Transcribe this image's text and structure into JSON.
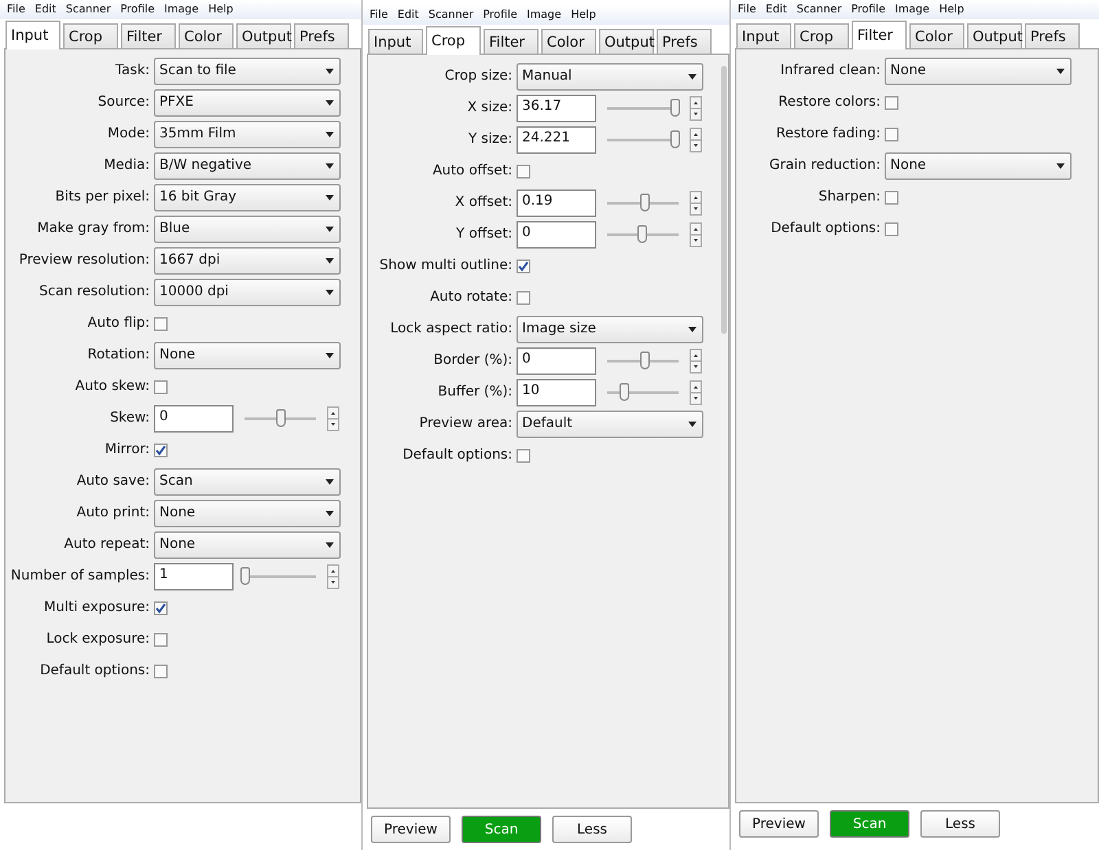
{
  "panels": [
    {
      "menu": [
        "File",
        "Edit",
        "Scanner",
        "Profile",
        "Image",
        "Help"
      ],
      "tabs": [
        {
          "label": "Input",
          "selected": true
        },
        {
          "label": "Crop",
          "selected": false
        },
        {
          "label": "Filter",
          "selected": false
        },
        {
          "label": "Color",
          "selected": false
        },
        {
          "label": "Output",
          "selected": false
        },
        {
          "label": "Prefs",
          "selected": false
        }
      ],
      "rows": [
        {
          "kind": "select",
          "label": "Task:",
          "value": "Scan to file"
        },
        {
          "kind": "select",
          "label": "Source:",
          "value": "PFXE"
        },
        {
          "kind": "select",
          "label": "Mode:",
          "value": "35mm Film"
        },
        {
          "kind": "select",
          "label": "Media:",
          "value": "B/W negative"
        },
        {
          "kind": "select",
          "label": "Bits per pixel:",
          "value": "16 bit Gray"
        },
        {
          "kind": "select",
          "label": "Make gray from:",
          "value": "Blue"
        },
        {
          "kind": "select",
          "label": "Preview resolution:",
          "value": "1667 dpi"
        },
        {
          "kind": "select",
          "label": "Scan resolution:",
          "value": "10000 dpi"
        },
        {
          "kind": "check",
          "label": "Auto flip:",
          "checked": false
        },
        {
          "kind": "select",
          "label": "Rotation:",
          "value": "None"
        },
        {
          "kind": "check",
          "label": "Auto skew:",
          "checked": false
        },
        {
          "kind": "spin",
          "label": "Skew:",
          "value": "0",
          "level": 0.5
        },
        {
          "kind": "check",
          "label": "Mirror:",
          "checked": true
        },
        {
          "kind": "select",
          "label": "Auto save:",
          "value": "Scan"
        },
        {
          "kind": "select",
          "label": "Auto print:",
          "value": "None"
        },
        {
          "kind": "select",
          "label": "Auto repeat:",
          "value": "None"
        },
        {
          "kind": "spin",
          "label": "Number of samples:",
          "value": "1",
          "level": 0
        },
        {
          "kind": "check",
          "label": "Multi exposure:",
          "checked": true
        },
        {
          "kind": "check",
          "label": "Lock exposure:",
          "checked": false
        },
        {
          "kind": "check",
          "label": "Default options:",
          "checked": false
        }
      ]
    },
    {
      "menu": [
        "File",
        "Edit",
        "Scanner",
        "Profile",
        "Image",
        "Help"
      ],
      "tabs": [
        {
          "label": "Input",
          "selected": false
        },
        {
          "label": "Crop",
          "selected": true
        },
        {
          "label": "Filter",
          "selected": false
        },
        {
          "label": "Color",
          "selected": false
        },
        {
          "label": "Output",
          "selected": false
        },
        {
          "label": "Prefs",
          "selected": false
        }
      ],
      "rows": [
        {
          "kind": "select",
          "label": "Crop size:",
          "value": "Manual"
        },
        {
          "kind": "spin",
          "label": "X size:",
          "value": "36.17",
          "level": 0.95
        },
        {
          "kind": "spin",
          "label": "Y size:",
          "value": "24.221",
          "level": 0.95
        },
        {
          "kind": "check",
          "label": "Auto offset:",
          "checked": false
        },
        {
          "kind": "spin",
          "label": "X offset:",
          "value": "0.19",
          "level": 0.52
        },
        {
          "kind": "spin",
          "label": "Y offset:",
          "value": "0",
          "level": 0.48
        },
        {
          "kind": "check",
          "label": "Show multi outline:",
          "checked": true
        },
        {
          "kind": "check",
          "label": "Auto rotate:",
          "checked": false
        },
        {
          "kind": "select",
          "label": "Lock aspect ratio:",
          "value": "Image size"
        },
        {
          "kind": "spin",
          "label": "Border (%):",
          "value": "0",
          "level": 0.52
        },
        {
          "kind": "spin",
          "label": "Buffer (%):",
          "value": "10",
          "level": 0.24
        },
        {
          "kind": "select",
          "label": "Preview area:",
          "value": "Default"
        },
        {
          "kind": "check",
          "label": "Default options:",
          "checked": false
        }
      ],
      "buttons": [
        {
          "label": "Preview",
          "kind": "plain"
        },
        {
          "label": "Scan",
          "kind": "primary"
        },
        {
          "label": "Less",
          "kind": "plain"
        }
      ]
    },
    {
      "menu": [
        "File",
        "Edit",
        "Scanner",
        "Profile",
        "Image",
        "Help"
      ],
      "tabs": [
        {
          "label": "Input",
          "selected": false
        },
        {
          "label": "Crop",
          "selected": false
        },
        {
          "label": "Filter",
          "selected": true
        },
        {
          "label": "Color",
          "selected": false
        },
        {
          "label": "Output",
          "selected": false
        },
        {
          "label": "Prefs",
          "selected": false
        }
      ],
      "rows": [
        {
          "kind": "select",
          "label": "Infrared clean:",
          "value": "None"
        },
        {
          "kind": "check",
          "label": "Restore colors:",
          "checked": false
        },
        {
          "kind": "check",
          "label": "Restore fading:",
          "checked": false
        },
        {
          "kind": "select",
          "label": "Grain reduction:",
          "value": "None"
        },
        {
          "kind": "check",
          "label": "Sharpen:",
          "checked": false
        },
        {
          "kind": "check",
          "label": "Default options:",
          "checked": false
        }
      ],
      "buttons": [
        {
          "label": "Preview",
          "kind": "plain"
        },
        {
          "label": "Scan",
          "kind": "primary"
        },
        {
          "label": "Less",
          "kind": "plain"
        }
      ]
    }
  ]
}
